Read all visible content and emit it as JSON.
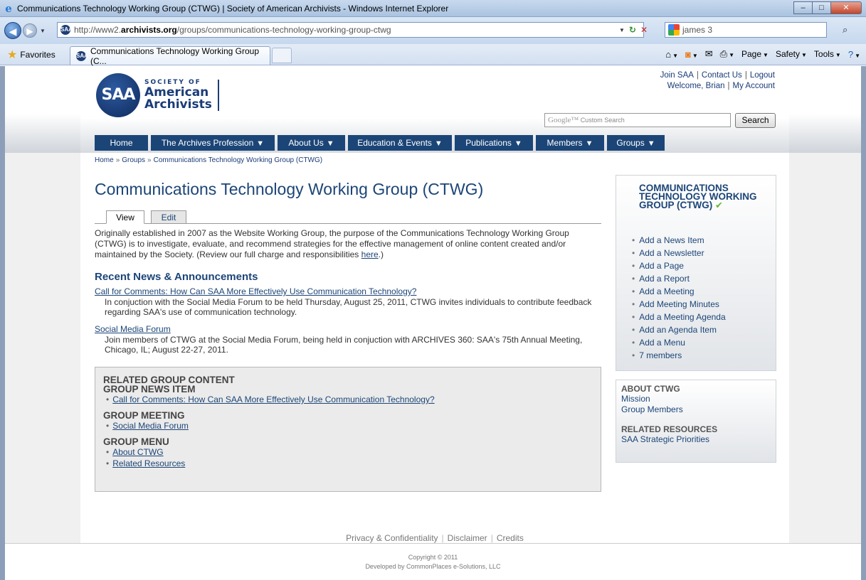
{
  "browser": {
    "window_title": "Communications Technology Working Group (CTWG) | Society of American Archivists - Windows Internet Explorer",
    "url_prefix": "http://www2.",
    "url_domain": "archivists.org",
    "url_path": "/groups/communications-technology-working-group-ctwg",
    "search_value": "james 3",
    "favorites_label": "Favorites",
    "tab_title": "Communications Technology Working Group (C...",
    "cmd_page": "Page",
    "cmd_safety": "Safety",
    "cmd_tools": "Tools",
    "icons": {
      "back": "back-arrow-icon",
      "forward": "forward-arrow-icon",
      "refresh": "refresh-icon",
      "stop": "stop-icon",
      "home": "home-icon",
      "feeds": "rss-icon",
      "mail": "mail-icon",
      "print": "print-icon",
      "help": "help-icon"
    }
  },
  "site": {
    "logo_initials": "SAA",
    "logo_line1": "SOCIETY OF",
    "logo_line2": "American",
    "logo_line3": "Archivists",
    "top_links": {
      "join": "Join SAA",
      "contact": "Contact Us",
      "logout": "Logout",
      "welcome": "Welcome, Brian",
      "account": "My Account"
    },
    "search_placeholder_brand": "Google™",
    "search_placeholder": "Custom Search",
    "search_button": "Search",
    "nav": [
      "Home",
      "The Archives Profession",
      "About Us",
      "Education & Events",
      "Publications",
      "Members",
      "Groups"
    ]
  },
  "breadcrumb": [
    "Home",
    "Groups",
    "Communications Technology Working Group (CTWG)"
  ],
  "main": {
    "title": "Communications Technology Working Group (CTWG)",
    "tab_view": "View",
    "tab_edit": "Edit",
    "intro_text": "Originally established in 2007 as the Website Working Group, the purpose of the Communications Technology Working Group (CTWG) is to investigate, evaluate, and recommend strategies for the effective management of online content created and/or maintained by the Society. (Review our full charge and responsibilities ",
    "intro_link": "here",
    "intro_end": ".)",
    "news_heading": "Recent News & Announcements",
    "news": [
      {
        "title": "Call for Comments: How Can SAA More Effectively Use Communication Technology?",
        "desc": "In conjuction with the Social Media Forum to be held Thursday, August 25, 2011, CTWG invites individuals to contribute feedback regarding SAA's use of communication technology."
      },
      {
        "title": "Social Media Forum",
        "desc": "Join members of CTWG at the Social Media Forum, being held in conjuction with ARCHIVES 360: SAA's 75th Annual Meeting, Chicago, IL; August 22-27, 2011."
      }
    ],
    "related": {
      "heading": "RELATED GROUP CONTENT",
      "news_item_heading": "GROUP NEWS ITEM",
      "news_item": "Call for Comments: How Can SAA More Effectively Use Communication Technology?",
      "meeting_heading": "GROUP MEETING",
      "meeting": "Social Media Forum",
      "menu_heading": "GROUP MENU",
      "menu": [
        "About CTWG",
        "Related Resources"
      ]
    }
  },
  "sidebar": {
    "group_title": "COMMUNICATIONS TECHNOLOGY WORKING GROUP (CTWG)",
    "actions": [
      "Add a News Item",
      "Add a Newsletter",
      "Add a Page",
      "Add a Report",
      "Add a Meeting",
      "Add Meeting Minutes",
      "Add a Meeting Agenda",
      "Add an Agenda Item",
      "Add a Menu",
      "7 members"
    ],
    "about_heading": "ABOUT CTWG",
    "about_links": [
      "Mission",
      "Group Members"
    ],
    "resources_heading": "RELATED RESOURCES",
    "resources_links": [
      "SAA Strategic Priorities"
    ]
  },
  "footer": {
    "links": [
      "Privacy & Confidentiality",
      "Disclaimer",
      "Credits"
    ],
    "copyright": "Copyright © 2011",
    "developer": "Developed by CommonPlaces e-Solutions, LLC"
  },
  "colors": {
    "brand_navy": "#1c4577",
    "checkmark": "#6bb33c"
  }
}
